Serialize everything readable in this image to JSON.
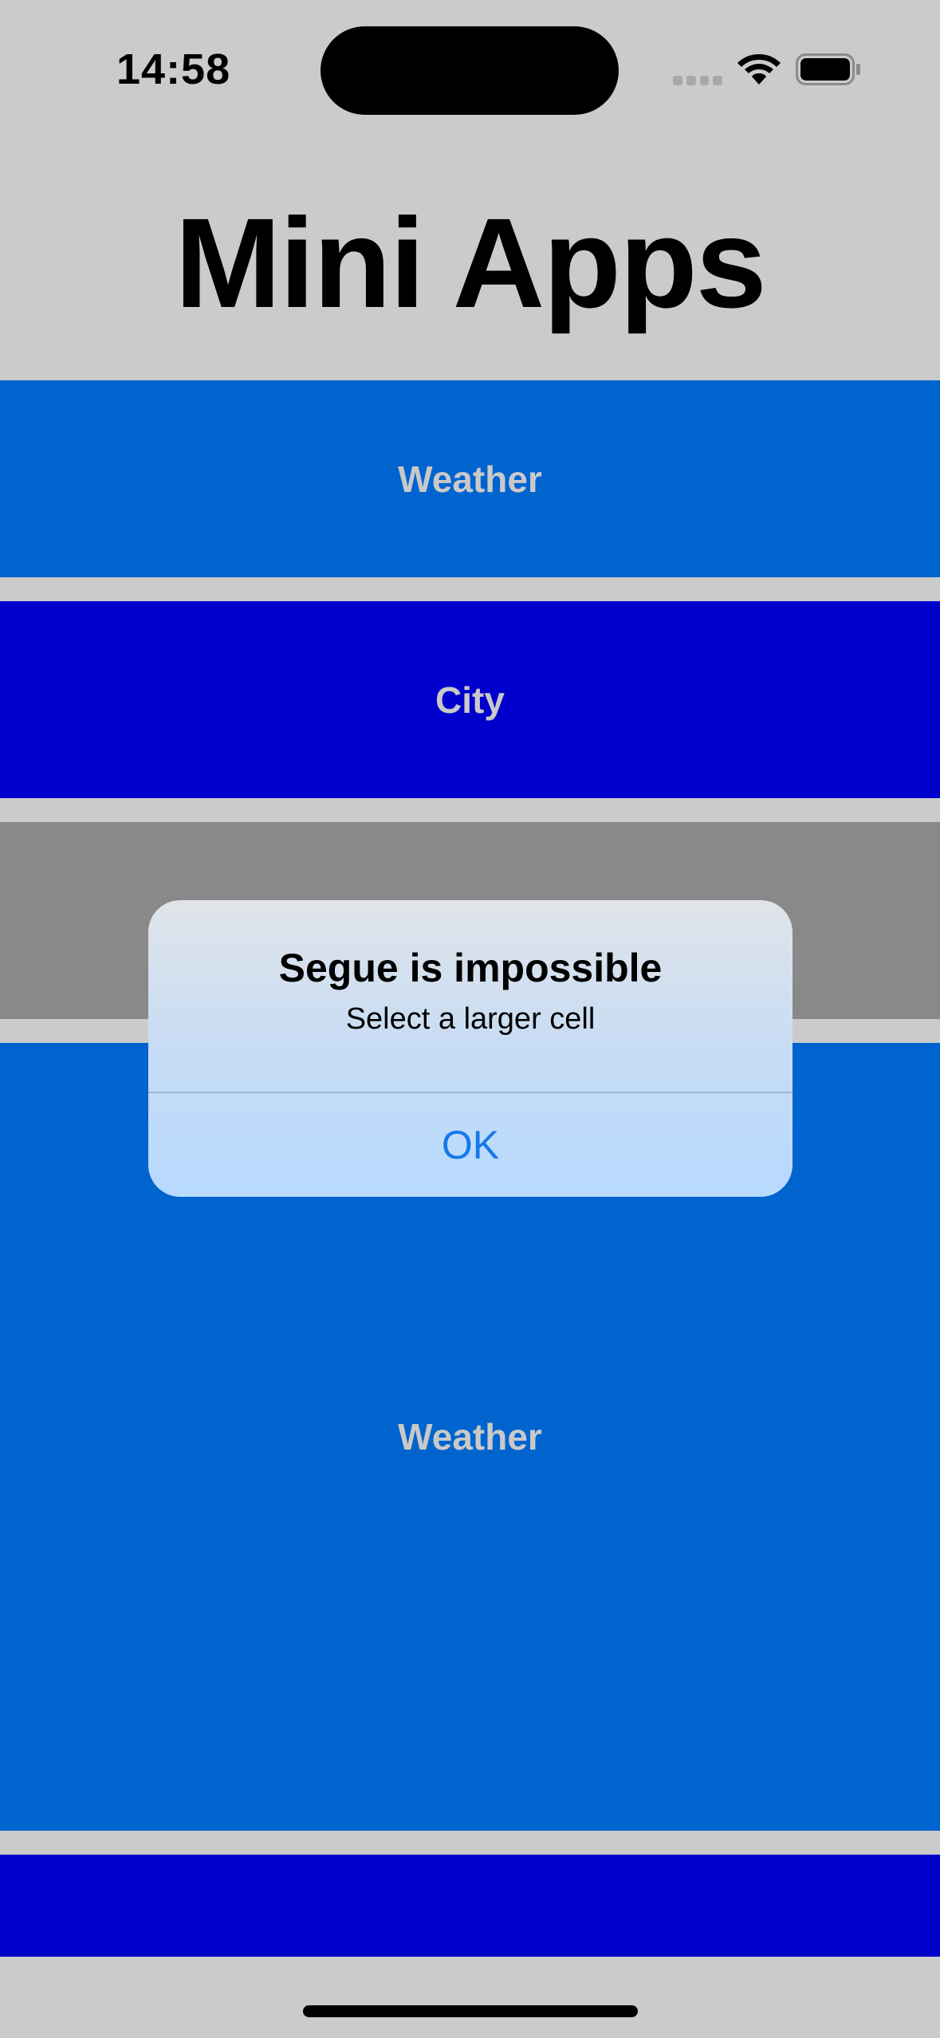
{
  "status_bar": {
    "time": "14:58",
    "icons": [
      "signal-icon",
      "wifi-icon",
      "battery-icon"
    ]
  },
  "header": {
    "title": "Mini Apps"
  },
  "cells": [
    {
      "label": "Weather",
      "color": "#0064cf"
    },
    {
      "label": "City",
      "color": "#0000cc"
    },
    {
      "label": "",
      "color": "#898989"
    },
    {
      "label": "Weather",
      "color": "#0064cf"
    },
    {
      "label": "",
      "color": "#0000cc"
    }
  ],
  "alert": {
    "title": "Segue is impossible",
    "message": "Select a larger cell",
    "ok_label": "OK"
  },
  "colors": {
    "background": "#cbcbcb",
    "accent": "#1479e8"
  }
}
